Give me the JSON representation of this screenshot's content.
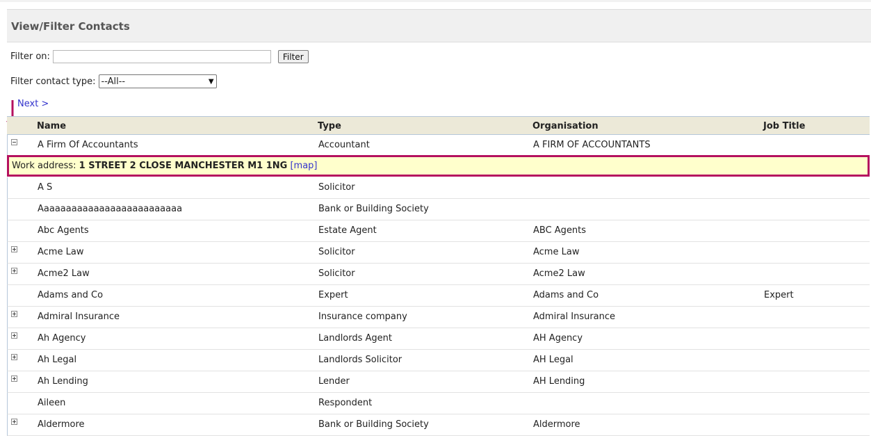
{
  "page": {
    "title": "View/Filter Contacts"
  },
  "filter": {
    "label": "Filter on:",
    "value": "",
    "button_label": "Filter",
    "type_label": "Filter contact type:",
    "type_selected": "--All--"
  },
  "pagination": {
    "next_label": "Next >"
  },
  "table": {
    "headers": {
      "name": "Name",
      "type": "Type",
      "organisation": "Organisation",
      "job_title": "Job Title"
    },
    "expanded": {
      "name": "A Firm Of Accountants",
      "type": "Accountant",
      "organisation": "A FIRM OF ACCOUNTANTS",
      "job_title": "",
      "toggle": "minus",
      "detail_label": "Work address:",
      "detail_address": "1 STREET 2 CLOSE MANCHESTER M1 1NG",
      "detail_link": "[map]"
    },
    "rows": [
      {
        "name": "A S",
        "type": "Solicitor",
        "organisation": "",
        "job_title": "",
        "toggle": "none"
      },
      {
        "name": "Aaaaaaaaaaaaaaaaaaaaaaaaaa",
        "type": "Bank or Building Society",
        "organisation": "",
        "job_title": "",
        "toggle": "none"
      },
      {
        "name": "Abc Agents",
        "type": "Estate Agent",
        "organisation": "ABC Agents",
        "job_title": "",
        "toggle": "none"
      },
      {
        "name": "Acme Law",
        "type": "Solicitor",
        "organisation": "Acme Law",
        "job_title": "",
        "toggle": "plus"
      },
      {
        "name": "Acme2 Law",
        "type": "Solicitor",
        "organisation": "Acme2 Law",
        "job_title": "",
        "toggle": "plus"
      },
      {
        "name": "Adams and Co",
        "type": "Expert",
        "organisation": "Adams and Co",
        "job_title": "Expert",
        "toggle": "none"
      },
      {
        "name": "Admiral Insurance",
        "type": "Insurance company",
        "organisation": "Admiral Insurance",
        "job_title": "",
        "toggle": "plus"
      },
      {
        "name": "Ah Agency",
        "type": "Landlords Agent",
        "organisation": "AH Agency",
        "job_title": "",
        "toggle": "plus"
      },
      {
        "name": "Ah Legal",
        "type": "Landlords Solicitor",
        "organisation": "AH Legal",
        "job_title": "",
        "toggle": "plus"
      },
      {
        "name": "Ah Lending",
        "type": "Lender",
        "organisation": "AH Lending",
        "job_title": "",
        "toggle": "plus"
      },
      {
        "name": "Aileen",
        "type": "Respondent",
        "organisation": "",
        "job_title": "",
        "toggle": "none"
      },
      {
        "name": "Aldermore",
        "type": "Bank or Building Society",
        "organisation": "Aldermore",
        "job_title": "",
        "toggle": "plus"
      }
    ]
  },
  "colors": {
    "highlight_border": "#b5115f",
    "detail_background": "#ffffcc",
    "link": "#3333cc",
    "header_background": "#ece9d8"
  },
  "icons": {
    "annotation": "arrow-down-icon",
    "expand": "plus-box-icon",
    "collapse": "minus-box-icon"
  }
}
